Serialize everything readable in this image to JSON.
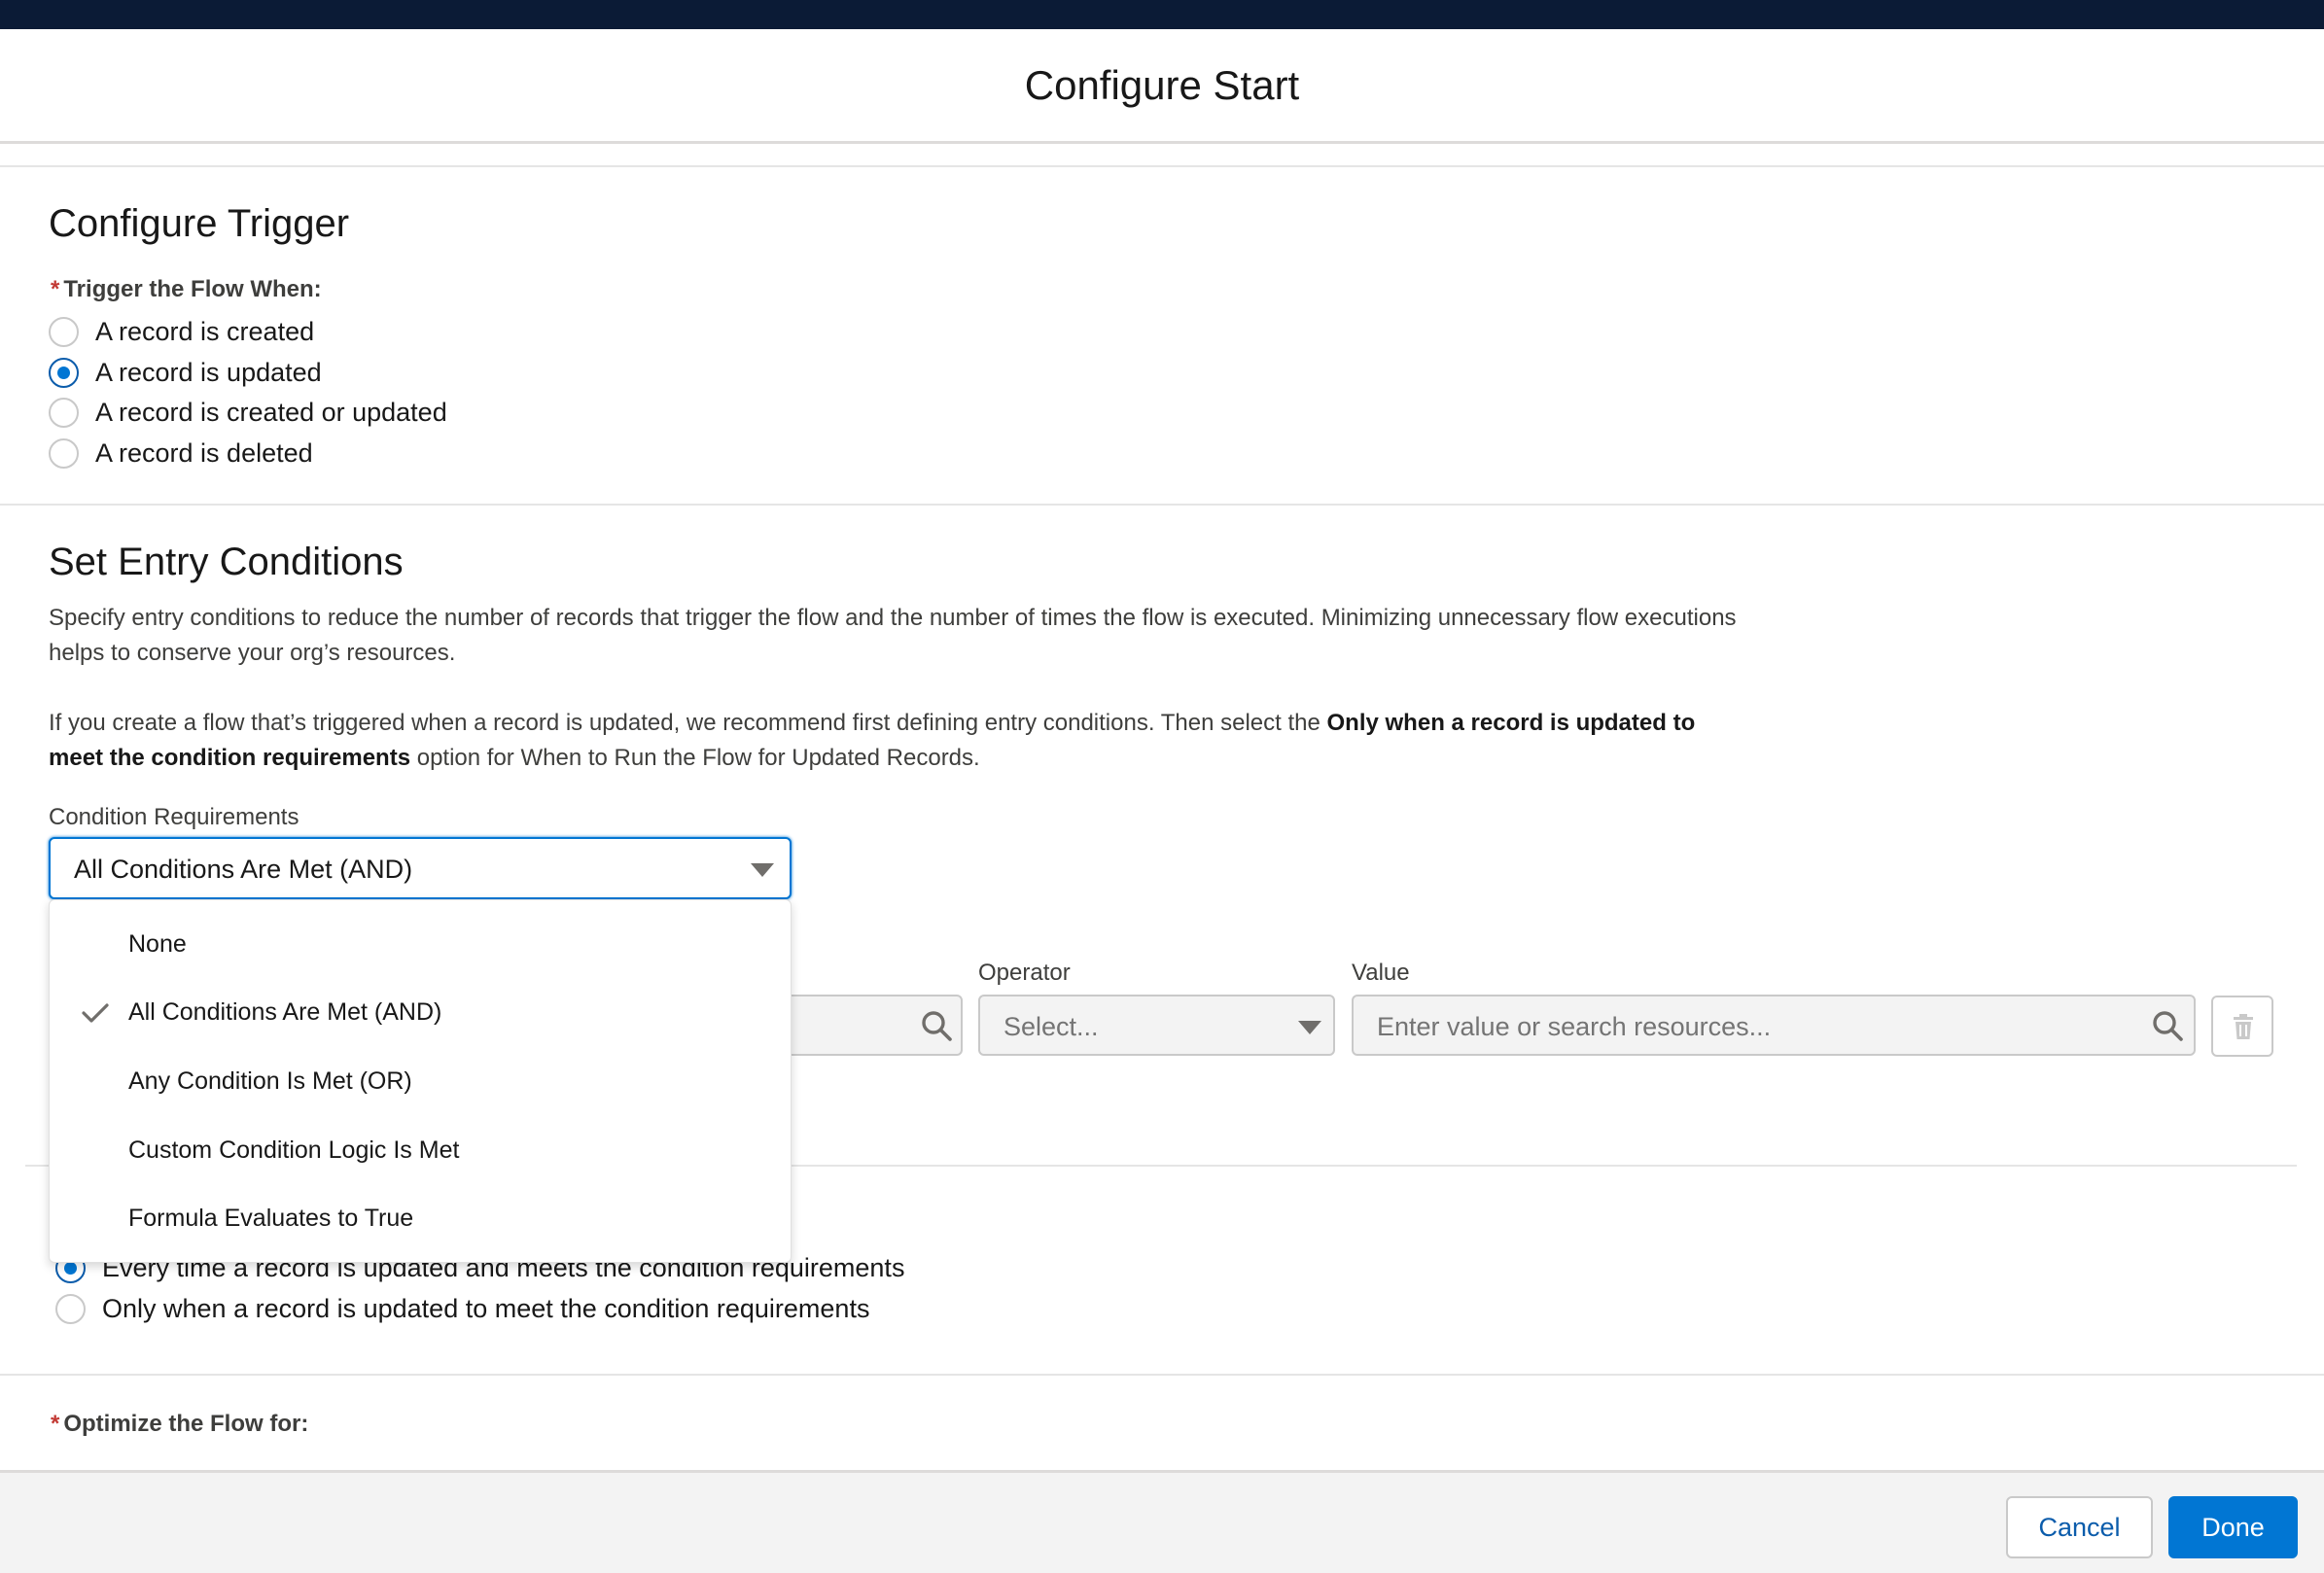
{
  "modal": {
    "title": "Configure Start"
  },
  "trigger": {
    "heading": "Configure Trigger",
    "required_mark": "*",
    "label": "Trigger the Flow When:",
    "options": [
      {
        "label": "A record is created",
        "selected": false
      },
      {
        "label": "A record is updated",
        "selected": true
      },
      {
        "label": "A record is created or updated",
        "selected": false
      },
      {
        "label": "A record is deleted",
        "selected": false
      }
    ]
  },
  "entry": {
    "heading": "Set Entry Conditions",
    "description_1": "Specify entry conditions to reduce the number of records that trigger the flow and the number of times the flow is executed. Minimizing unnecessary flow executions helps to conserve your org’s resources.",
    "description_2_pre": "If you create a flow that’s triggered when a record is updated, we recommend first defining entry conditions. Then select the ",
    "description_2_bold": "Only when a record is updated to meet the condition requirements",
    "description_2_post": " option for When to Run the Flow for Updated Records.",
    "condition_requirements_label": "Condition Requirements",
    "condition_requirements_value": "All Conditions Are Met (AND)",
    "dropdown_options": [
      {
        "label": "None",
        "checked": false
      },
      {
        "label": "All Conditions Are Met (AND)",
        "checked": true
      },
      {
        "label": "Any Condition Is Met (OR)",
        "checked": false
      },
      {
        "label": "Custom Condition Logic Is Met",
        "checked": false
      },
      {
        "label": "Formula Evaluates to True",
        "checked": false
      }
    ],
    "operator_label": "Operator",
    "operator_placeholder": "Select...",
    "value_label": "Value",
    "value_placeholder": "Enter value or search resources..."
  },
  "run_when": {
    "options": [
      {
        "label": "Every time a record is updated and meets the condition requirements",
        "selected": true
      },
      {
        "label": "Only when a record is updated to meet the condition requirements",
        "selected": false
      }
    ]
  },
  "optimize": {
    "required_mark": "*",
    "label": "Optimize the Flow for:"
  },
  "footer": {
    "cancel_label": "Cancel",
    "done_label": "Done"
  },
  "colors": {
    "brand": "#0176d3",
    "topbar": "#0b1b36",
    "required": "#c23934"
  }
}
